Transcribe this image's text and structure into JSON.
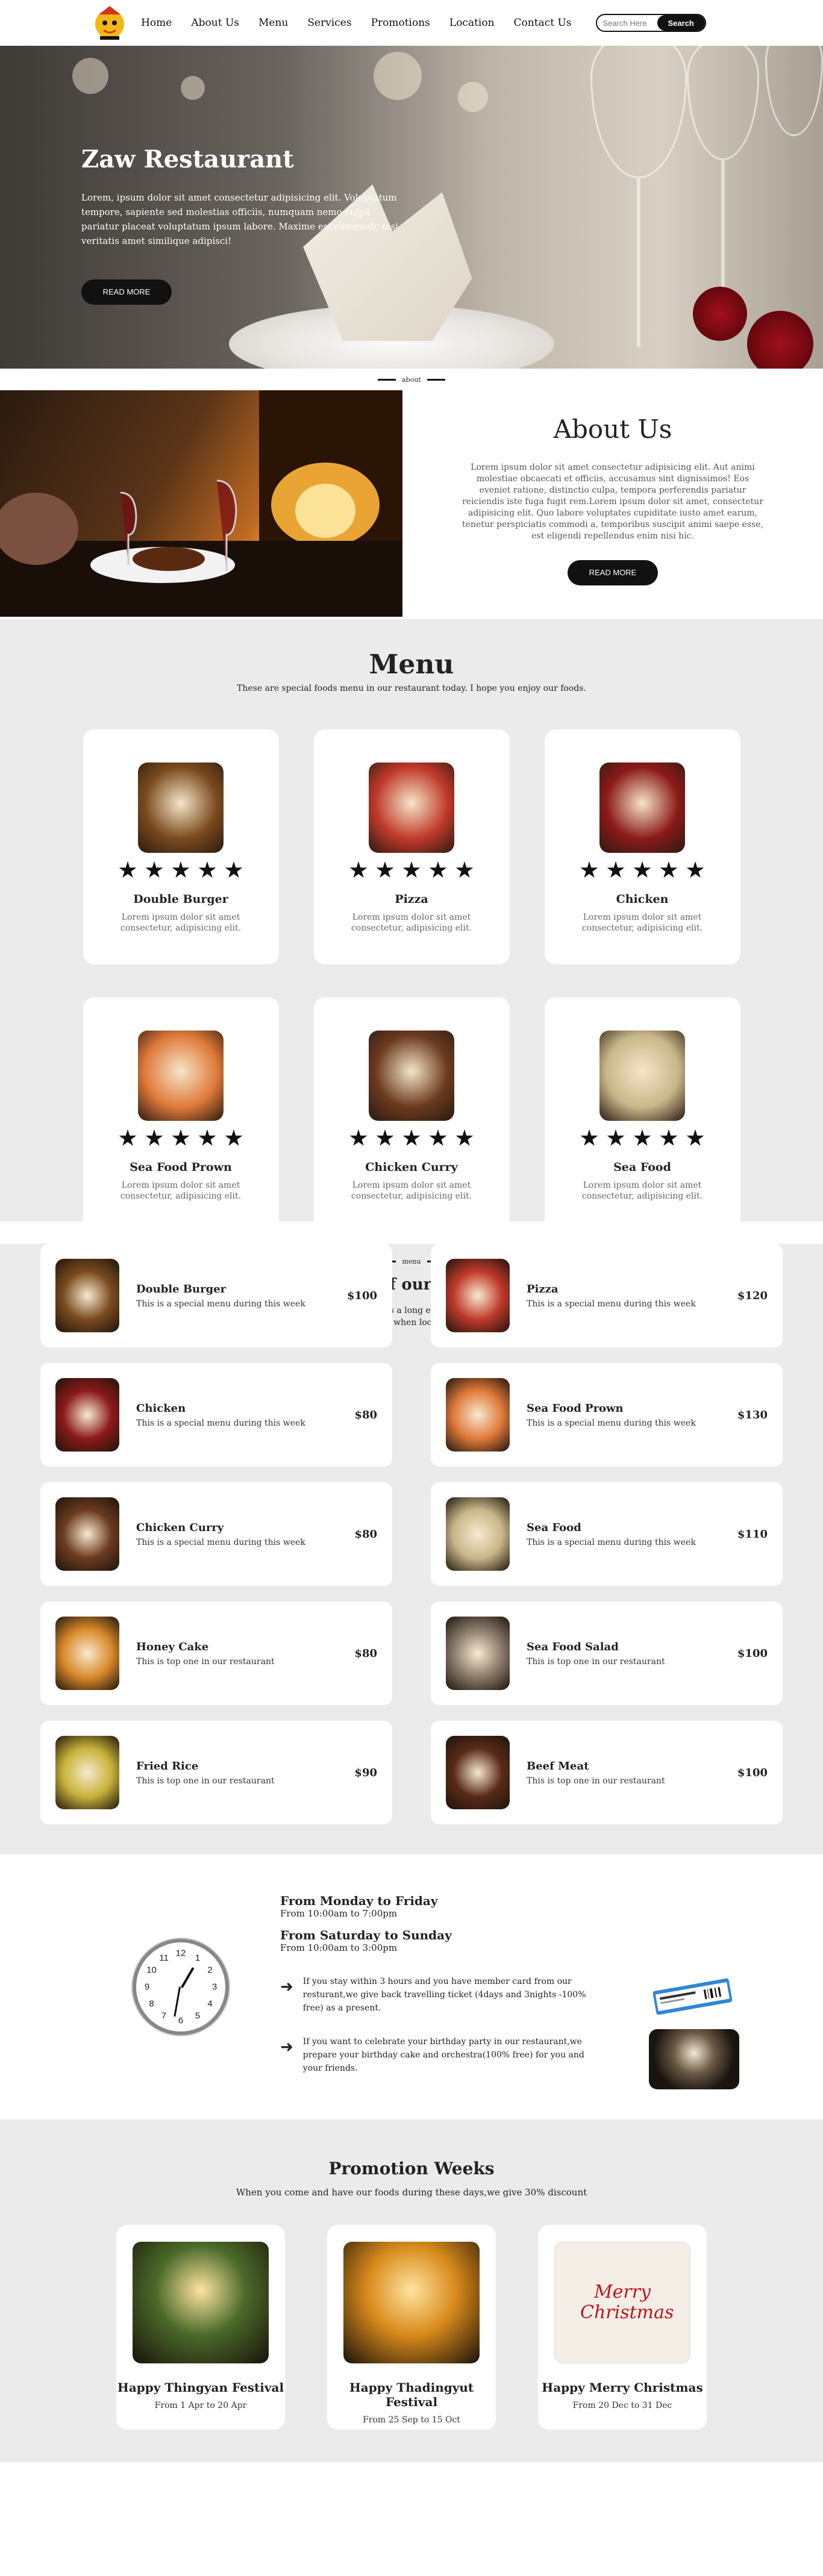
{
  "nav": {
    "links": [
      "Home",
      "About Us",
      "Menu",
      "Services",
      "Promotions",
      "Location",
      "Contact Us"
    ],
    "search_placeholder": "Search Here",
    "search_button": "Search"
  },
  "hero": {
    "title": "Zaw Restaurant",
    "text": "Lorem, ipsum dolor sit amet consectetur adipisicing elit. Voluptatum tempore, sapiente sed molestias officiis, numquam nemo culpa pariatur placeat voluptatum ipsum labore. Maxime est commodi, nisi veritatis amet similique adipisci!",
    "button": "READ MORE"
  },
  "dividers": {
    "about": "about",
    "menu": "menu"
  },
  "about": {
    "title": "About Us",
    "text": "Lorem ipsum dolor sit amet consectetur adipisicing elit. Aut animi molestiae obcaecati et officiis, accusamus sint dignissimos! Eos eveniet ratione, distinctio culpa, tempora perferendis pariatur reiciendis iste fuga fugit rem.Lorem ipsum dolor sit amet, consectetur adipisicing elit. Quo labore voluptates cupiditate iusto amet earum, tenetur perspiciatis commodi a, temporibus suscipit animi saepe esse, est eligendi repellendus enim nisi hic.",
    "button": "READ MORE"
  },
  "menu": {
    "title": "Menu",
    "subtitle": "These are special foods menu in our restaurant today. I hope you enjoy our foods.",
    "card_text": "Lorem ipsum dolor sit amet consectetur, adipisicing elit.",
    "rating": 5,
    "cards": [
      {
        "name": "Double Burger",
        "color": "#7a4a1e"
      },
      {
        "name": "Pizza",
        "color": "#c0392b"
      },
      {
        "name": "Chicken",
        "color": "#8b1a1a"
      },
      {
        "name": "Sea Food Prown",
        "color": "#e07a3a"
      },
      {
        "name": "Chicken Curry",
        "color": "#6b3a1f"
      },
      {
        "name": "Sea Food",
        "color": "#c9b78a"
      }
    ]
  },
  "lists": {
    "title": "lists of our menu",
    "subtitle": "These are special foods in our restaurant during this week.It is a long established fact that a reader will be distracted by the readable content of a page when looking at its layout.",
    "items": [
      {
        "name": "Double Burger",
        "desc": "This is a special menu during this week",
        "price": "$100",
        "color": "#7a4a1e"
      },
      {
        "name": "Pizza",
        "desc": "This is a special menu during this week",
        "price": "$120",
        "color": "#c0392b"
      },
      {
        "name": "Chicken",
        "desc": "This is a special menu during this week",
        "price": "$80",
        "color": "#8b1a1a"
      },
      {
        "name": "Sea Food Prown",
        "desc": "This is a special menu during this week",
        "price": "$130",
        "color": "#e07a3a"
      },
      {
        "name": "Chicken Curry",
        "desc": "This is a special menu during this week",
        "price": "$80",
        "color": "#6b3a1f"
      },
      {
        "name": "Sea Food",
        "desc": "This is a special menu during this week",
        "price": "$110",
        "color": "#c9b78a"
      },
      {
        "name": "Honey Cake",
        "desc": "This is top one in our restaurant",
        "price": "$80",
        "color": "#d98a2b"
      },
      {
        "name": "Sea Food Salad",
        "desc": "This is top one in our restaurant",
        "price": "$100",
        "color": "#8a7a6a"
      },
      {
        "name": "Fried Rice",
        "desc": "This is top one in our restaurant",
        "price": "$90",
        "color": "#c8b23a"
      },
      {
        "name": "Beef Meat",
        "desc": "This is top one in our restaurant",
        "price": "$100",
        "color": "#5a2a18"
      }
    ]
  },
  "hours": {
    "weekday_title": "From Monday to Friday",
    "weekday_time": "From 10:00am to 7:00pm",
    "weekend_title": "From Saturday to Sunday",
    "weekend_time": "From 10:00am to 3:00pm",
    "offer1": "If you stay within 3 hours and you have member card from our resturant,we give back travelling ticket (4days and 3nights -100% free) as a present.",
    "offer2": "If you want to celebrate your birthday party in our restaurant,we prepare your birthday cake and orchestra(100% free) for you and your friends."
  },
  "promotions": {
    "title": "Promotion Weeks",
    "subtitle": "When you come and have our foods during these days,we give 30% discount",
    "cards": [
      {
        "name": "Happy Thingyan Festival",
        "date": "From 1 Apr to 20 Apr",
        "color": "#4a6a2a"
      },
      {
        "name": "Happy Thadingyut Festival",
        "date": "From 25 Sep to 15 Oct",
        "color": "#d88a1a"
      },
      {
        "name": "Happy Merry Christmas",
        "date": "From 20 Dec to 31 Dec",
        "color": "#f4eee6",
        "art_text": "Merry Christmas"
      }
    ]
  },
  "colors": {
    "dark": "#111111",
    "section_bg": "#ebebeb"
  }
}
